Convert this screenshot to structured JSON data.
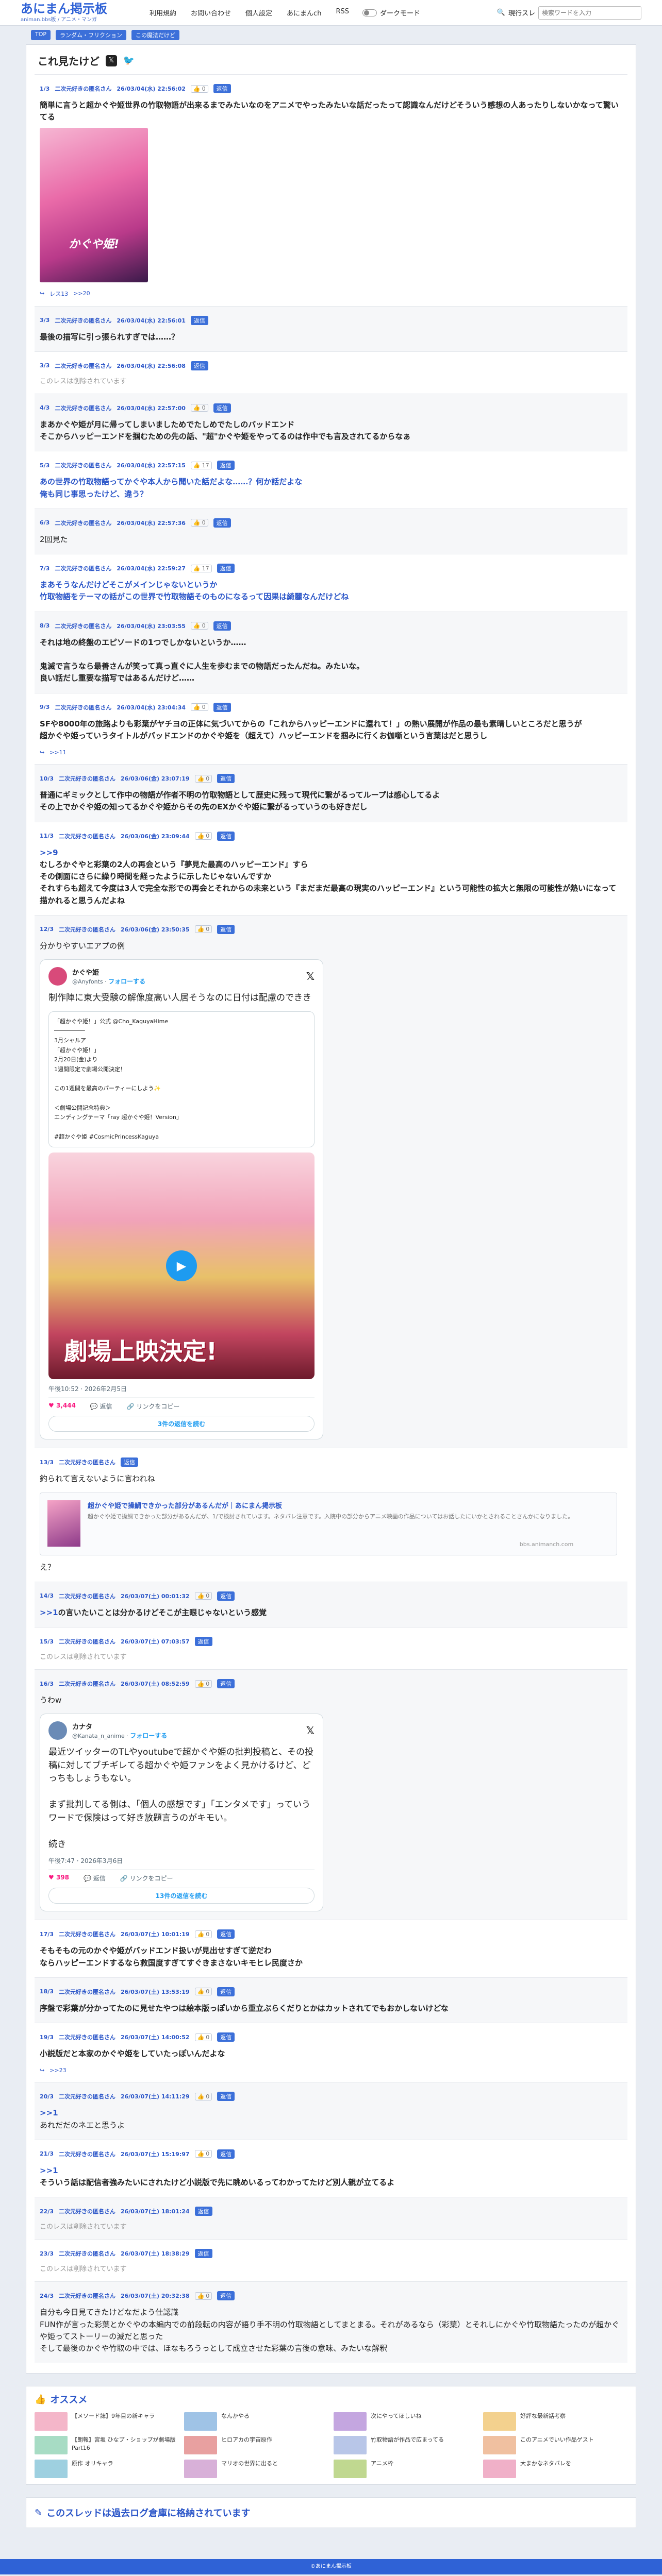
{
  "header": {
    "logo": "あにまん掲示板",
    "logo_sub": "animan.bbs板 / アニメ・マンガ",
    "nav": [
      "利用規約",
      "お問い合わせ",
      "個人設定",
      "あにまんch",
      "RSS"
    ],
    "dark_mode_label": "ダークモード",
    "search_label": "現行スレ",
    "search_placeholder": "検索ワードを入力"
  },
  "breadcrumb": [
    "TOP",
    "ランダム・フリクション",
    "この魔法だけど"
  ],
  "thread": {
    "title": "これ見たけど",
    "posts": [
      {
        "no": "1/3",
        "name": "二次元好きの匿名さん",
        "date": "26/03/04(水) 22:56:02",
        "good": "0",
        "body": "簡単に言うと超かぐや姫世界の竹取物語が出来るまでみたいなのをアニメでやったみたいな話だったって認識なんだけどそういう感想の人あったりしないかなって驚いてる",
        "image": true,
        "image_caption": "かぐや姫!",
        "links": [
          "レス13",
          ">>20"
        ]
      },
      {
        "no": "3/3",
        "name": "二次元好きの匿名さん",
        "date": "26/03/04(水) 22:56:01",
        "good": "",
        "body": "最後の描写に引っ張られすぎでは……？"
      },
      {
        "no": "3/3",
        "name": "二次元好きの匿名さん",
        "date": "26/03/04(水) 22:56:08",
        "good": "",
        "deleted": "このレスは削除されています"
      },
      {
        "no": "4/3",
        "name": "二次元好きの匿名さん",
        "date": "26/03/04(水) 22:57:00",
        "good": "0",
        "body": "まあかぐや姫が月に帰ってしまいましためでたしめでたしのバッドエンド\nそこからハッピーエンドを掴むための先の話、\"超\"かぐや姫をやってるのは作中でも言及されてるからなぁ"
      },
      {
        "no": "5/3",
        "name": "二次元好きの匿名さん",
        "date": "26/03/04(水) 22:57:15",
        "good": "17",
        "blue": true,
        "body": "あの世界の竹取物語ってかぐや本人から聞いた話だよな……？何か話だよな\n俺も同じ事思ったけど、違う？"
      },
      {
        "no": "6/3",
        "name": "二次元好きの匿名さん",
        "date": "26/03/04(水) 22:57:36",
        "good": "0",
        "plain": true,
        "body": "2回見た"
      },
      {
        "no": "7/3",
        "name": "二次元好きの匿名さん",
        "date": "26/03/04(水) 22:59:27",
        "good": "17",
        "blue": true,
        "body": "まあそうなんだけどそこがメインじゃないというか\n竹取物語をテーマの話がこの世界で竹取物語そのものになるって因果は綺麗なんだけどね"
      },
      {
        "no": "8/3",
        "name": "二次元好きの匿名さん",
        "date": "26/03/04(水) 23:03:55",
        "good": "0",
        "body": "それは地の終盤のエピソードの1つでしかないというか……\n\n鬼滅で言うなら最善さんが笑って真っ直ぐに人生を歩むまでの物語だったんだね。みたいな。\n良い話だし重要な描写ではあるんだけど……"
      },
      {
        "no": "9/3",
        "name": "二次元好きの匿名さん",
        "date": "26/03/04(水) 23:04:34",
        "good": "0",
        "body": "SFや8000年の旅路よりも彩葉がヤチヨの正体に気づいてからの「これからハッピーエンドに還れて！」の熱い展開が作品の最も素晴しいところだと思うが\n超かぐや姫っていうタイトルがバッドエンドのかぐや姫を（超えて）ハッピーエンドを掴みに行くお伽噺という言葉はだと思うし",
        "links": [
          ">>11"
        ]
      },
      {
        "no": "10/3",
        "name": "二次元好きの匿名さん",
        "date": "26/03/06(金) 23:07:19",
        "good": "0",
        "body": "普通にギミックとして作中の物語が作者不明の竹取物語として歴史に残って現代に繋がるってループは感心してるよ\nその上でかぐや姫の知ってるかぐや姫からその先のEXかぐや姫に繋がるっていうのも好きだし"
      },
      {
        "no": "11/3",
        "name": "二次元好きの匿名さん",
        "date": "26/03/06(金) 23:09:44",
        "good": "0",
        "anchor": ">>9",
        "body": "むしろかぐやと彩葉の2人の再会という『夢見た最高のハッピーエンド』すら\nその側面にさらに繰り時間を経ったように示したじゃないんですか\nそれすらも超えて今度は3人で完全な形での再会とそれからの未来という『まだまだ最高の現実のハッピーエンド』という可能性の拡大と無限の可能性が熱いになって描かれると思うんだよね"
      },
      {
        "no": "12/3",
        "name": "二次元好きの匿名さん",
        "date": "26/03/06(金) 23:50:35",
        "good": "0",
        "plain": true,
        "body": "分かりやすいエアプの例",
        "tweet": 1
      },
      {
        "no": "13/3",
        "name": "二次元好きの匿名さん",
        "date": "",
        "good": "",
        "plain": true,
        "body": "釣られて言えないように言われね",
        "card": true,
        "after": "え？"
      },
      {
        "no": "14/3",
        "name": "二次元好きの匿名さん",
        "date": "26/03/07(土) 00:01:32",
        "good": "0",
        "anchor": ">>1",
        "body": "の言いたいことは分かるけどそこが主眼じゃないという感覚"
      },
      {
        "no": "15/3",
        "name": "二次元好きの匿名さん",
        "date": "26/03/07(土) 07:03:57",
        "good": "",
        "deleted": "このレスは削除されています"
      },
      {
        "no": "16/3",
        "name": "二次元好きの匿名さん",
        "date": "26/03/07(土) 08:52:59",
        "good": "0",
        "plain": true,
        "body": "うわw",
        "tweet": 2
      },
      {
        "no": "17/3",
        "name": "二次元好きの匿名さん",
        "date": "26/03/07(土) 10:01:19",
        "good": "0",
        "body": "そもそもの元のかぐや姫がバッドエンド扱いが見出せすぎて逆だわ\nならハッピーエンドするなら救国度すぎてすぐきまさないキモヒレ民度さか"
      },
      {
        "no": "18/3",
        "name": "二次元好きの匿名さん",
        "date": "26/03/07(土) 13:53:19",
        "good": "0",
        "body": "序盤で彩葉が分かってたのに見せたやつは絵本版っぽいから重立ぶらくだりとかはカットされてでもおかしないけどな"
      },
      {
        "no": "19/3",
        "name": "二次元好きの匿名さん",
        "date": "26/03/07(土) 14:00:52",
        "good": "0",
        "body": "小説版だと本家のかぐや姫をしていたっぽいんだよな",
        "links": [
          ">>23"
        ]
      },
      {
        "no": "20/3",
        "name": "二次元好きの匿名さん",
        "date": "26/03/07(土) 14:11:29",
        "good": "0",
        "anchor": ">>1",
        "plain": true,
        "body": "あれだだのネエと思うよ"
      },
      {
        "no": "21/3",
        "name": "二次元好きの匿名さん",
        "date": "26/03/07(土) 15:19:97",
        "good": "0",
        "anchor": ">>1",
        "body": "そういう話は配信者強みたいにされたけど小説版で先に眺めいるってわかってたけど別人親が立てるよ"
      },
      {
        "no": "22/3",
        "name": "二次元好きの匿名さん",
        "date": "26/03/07(土) 18:01:24",
        "good": "",
        "deleted": "このレスは削除されています"
      },
      {
        "no": "23/3",
        "name": "二次元好きの匿名さん",
        "date": "26/03/07(土) 18:38:29",
        "good": "",
        "deleted": "このレスは削除されています"
      },
      {
        "no": "24/3",
        "name": "二次元好きの匿名さん",
        "date": "26/03/07(土) 20:32:38",
        "good": "0",
        "plain": true,
        "body": "自分も今日見てきたけどなだよう仕認識\nFUN作が言った彩葉とかぐやの本編内での前段転の内容が語り手不明の竹取物語としてまとまる。それがあるなら（彩葉）とそれしにかぐや竹取物語たったのが超かぐや姫ってストーリーの滅だと思った\nそして最後のかぐや竹取の中では、ほなもろうっとして成立させた彩葉の言後の意味、みたいな解釈"
      }
    ]
  },
  "tweet1": {
    "name": "かぐや姫",
    "handle": "@Anyfonts",
    "follow": "フォローする",
    "text": "制作陣に東大受験の解像度高い人居そうなのに日付は配慮のできき",
    "quote": "「超かぐや姫！」公式 @Cho_KaguyaHime\n─────────\n3月シャルア\n「超かぐや姫！」\n2月20日(金)より\n1週間限定で劇場公開決定！\n\nこの1週間を最高のパーティーにしよう✨\n\n＜劇場公開記念特典＞\nエンディングテーマ「ray 超かぐや姫！Version」\n\n#超かぐや姫 #CosmicPrincessKaguya",
    "media_caption": "劇場上映決定!",
    "time": "午後10:52 · 2026年2月5日",
    "likes": "3,444",
    "reply": "返信",
    "copy": "リンクをコピー",
    "more": "3件の返信を読む"
  },
  "tweet2": {
    "name": "カナタ",
    "handle": "@Kanata_n_anime",
    "follow": "フォローする",
    "text": "最近ツイッターのTLやyoutubeで超かぐや姫の批判投稿と、その投稿に対してブチギレてる超かぐや姫ファンをよく見かけるけど、どっちもしょうもない。\n\nまず批判してる側は、「個人の感想です」「エンタメです」っていうワードで保険はって好き放題言うのがキモい。\n\n続き",
    "time": "午後7:47 · 2026年3月6日",
    "likes": "398",
    "reply": "返信",
    "copy": "リンクをコピー",
    "more": "13件の返信を読む"
  },
  "link_card": {
    "title": "超かぐや姫で操鯛できかった部分があるんだが｜あにまん掲示板",
    "desc": "超かぐや姫で操鯛できかった部分があるんだが、1/で検討されています。ネタバレ注意です。入院中の部分からアニメ映画の作品についてはお話したにいかとされることさんかになりました。",
    "url": "bbs.animanch.com"
  },
  "osusume": {
    "title": "オススメ",
    "items": [
      "【メソード誌】9年目の新キャラ",
      "なんかやる",
      "次にやってほしいね",
      "好評な最新話考察",
      "【朗報】宮坂 ひなプ・ショップが劇場版 Part16",
      "ヒロアカの宇宙原作",
      "竹取物語が作品で広まってる",
      "このアニメでいい作品ゲスト",
      "原作 オリキャラ",
      "マリオの世界に出ると",
      "アニメ枠",
      "大まかなネタバレを"
    ]
  },
  "archive_title": "このスレッドは過去ログ倉庫に格納されています",
  "footer": "©あにまん掲示板",
  "colors": {
    "accent": "#2f62d6",
    "link": "#2a55c8",
    "pink": "#f91880",
    "twitter": "#1d9bf0"
  }
}
